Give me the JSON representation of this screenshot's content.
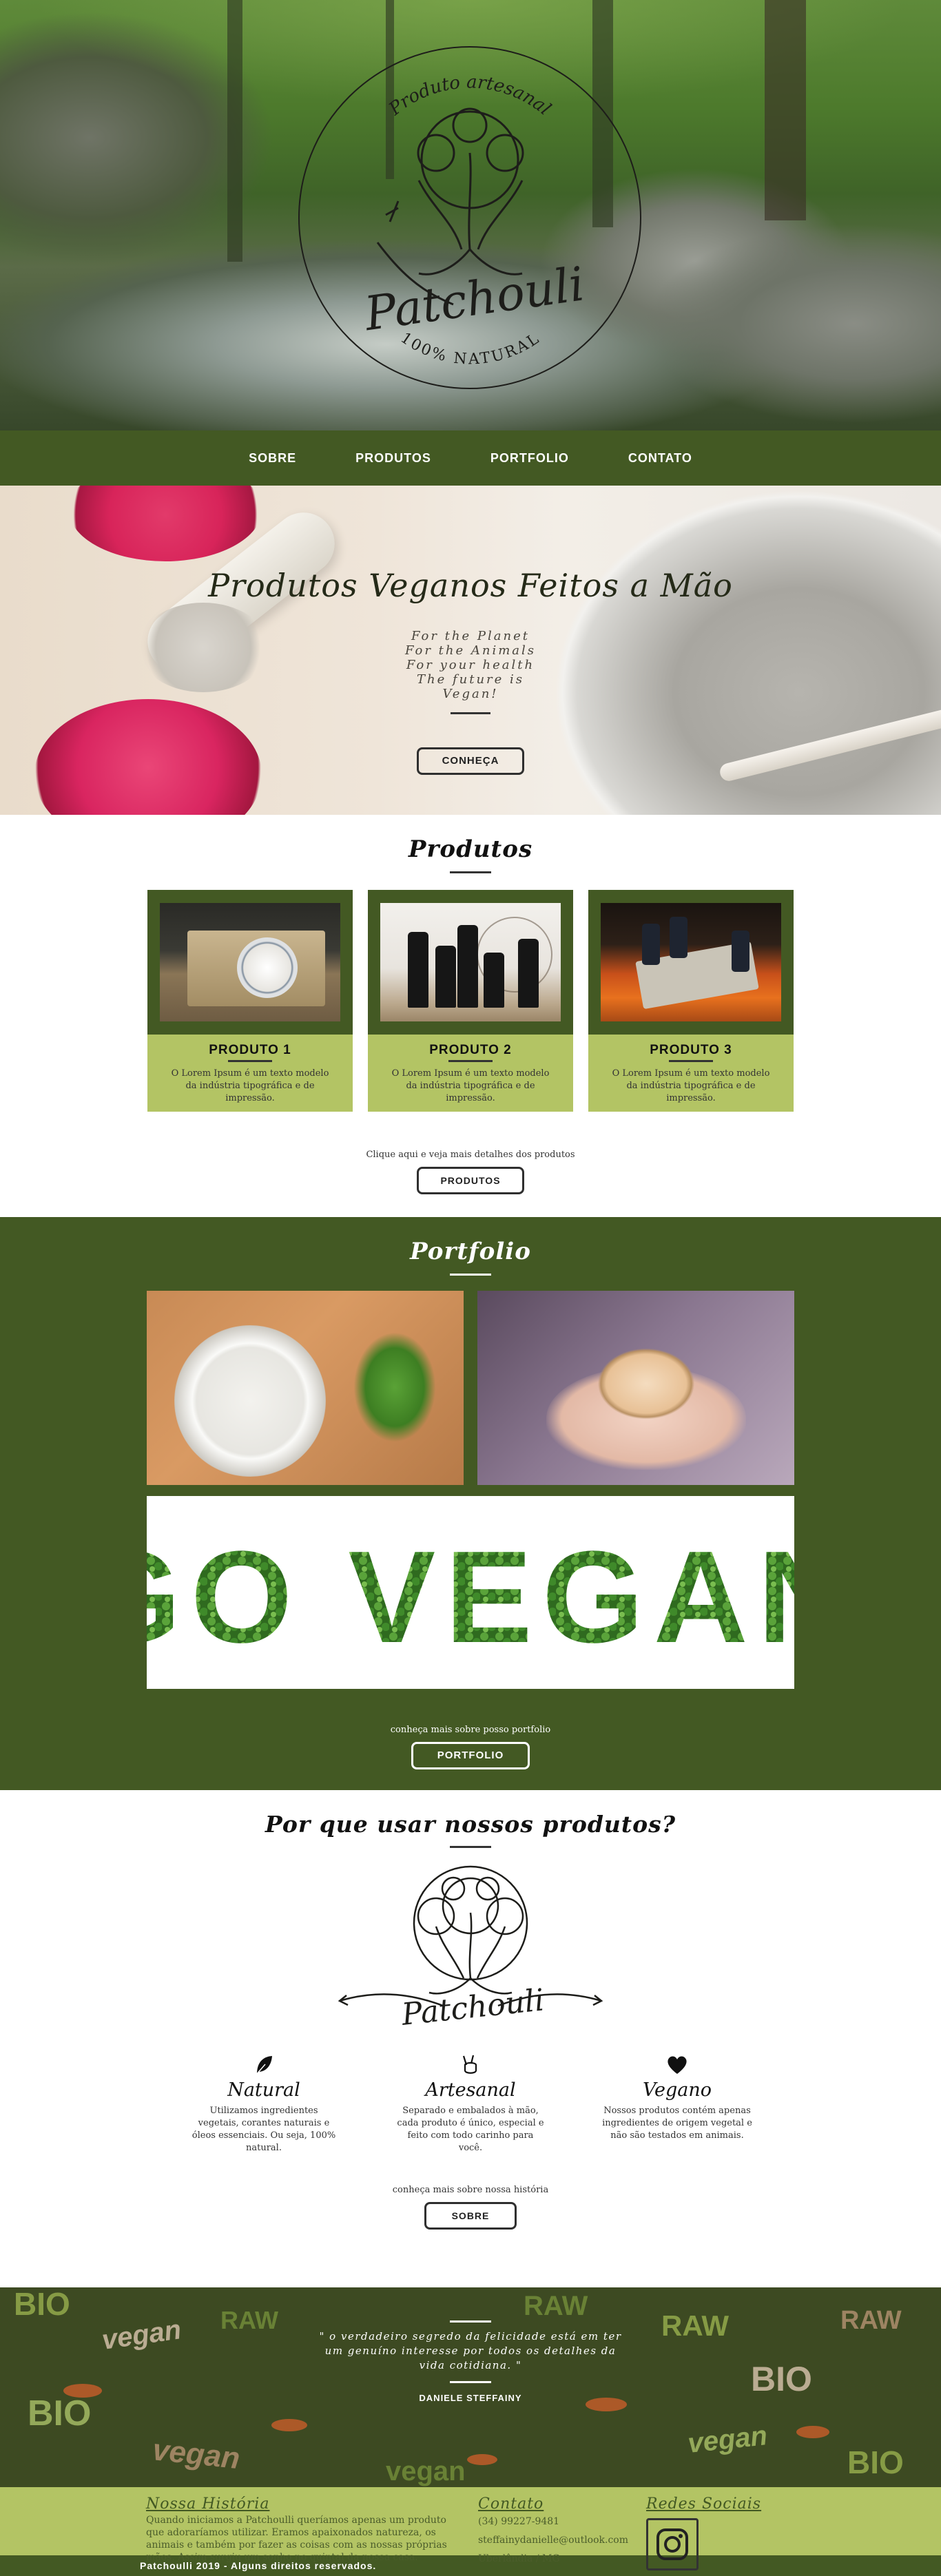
{
  "hero": {
    "logo_top_text": "Produto artesanal",
    "logo_name": "Patchouli",
    "logo_bottom_text": "100% NATURAL"
  },
  "nav": {
    "items": [
      "SOBRE",
      "PRODUTOS",
      "PORTFOLIO",
      "CONTATO"
    ]
  },
  "banner": {
    "title": "Produtos Veganos Feitos a Mão",
    "tagline": [
      "For the Planet",
      "For the Animals",
      "For your health",
      "The future is",
      "Vegan!"
    ],
    "button": "CONHEÇA"
  },
  "produtos": {
    "title": "Produtos",
    "cards": [
      {
        "name": "PRODUTO 1",
        "text": "O Lorem Ipsum é um texto modelo da indústria tipográfica e de impressão."
      },
      {
        "name": "PRODUTO 2",
        "text": "O Lorem Ipsum é um texto modelo da indústria tipográfica e de impressão."
      },
      {
        "name": "PRODUTO 3",
        "text": "O Lorem Ipsum é um texto modelo da indústria tipográfica e de impressão."
      }
    ],
    "hint": "Clique aqui e veja mais detalhes dos produtos",
    "button": "PRODUTOS"
  },
  "portfolio": {
    "title": "Portfolio",
    "banner_text": "GO VEGAN",
    "hint": "conheça mais sobre posso portfolio",
    "button": "PORTFOLIO"
  },
  "why": {
    "title": "Por que usar nossos produtos?",
    "logo_name": "Patchouli",
    "features": [
      {
        "icon": "leaf-icon",
        "title": "Natural",
        "text": "Utilizamos ingredientes vegetais, corantes naturais e óleos essenciais. Ou seja, 100% natural."
      },
      {
        "icon": "peace-hand-icon",
        "title": "Artesanal",
        "text": "Separado e embalados à mão, cada produto é único, especial e feito com todo carinho para você."
      },
      {
        "icon": "heart-icon",
        "title": "Vegano",
        "text": "Nossos produtos contém apenas ingredientes de origem vegetal e não são testados em animais."
      }
    ],
    "hint": "conheça mais sobre nossa história",
    "button": "SOBRE"
  },
  "quote": {
    "lines": [
      "\" o verdadeiro segredo da felicidade está em ter",
      "um genuíno interesse por todos os detalhes da",
      "vida cotidiana. \""
    ],
    "author": "DANIELE STEFFAINY",
    "pattern_words": [
      "BIO",
      "vegan",
      "RAW",
      "BIO",
      "vegan",
      "RAW"
    ]
  },
  "footer": {
    "history_title": "Nossa História",
    "history_text": "Quando iniciamos a Patchoulli queríamos apenas um produto que adoraríamos utilizar. Eramos apaixonados natureza, os animais e também por fazer as coisas com as nossas próprias mãos. Assim surgiu um sonho no quintal da nossa casa.",
    "contact_title": "Contato",
    "phone": "(34) 99227-9481",
    "email": "steffainydanielle@outlook.com",
    "city": "Uberlândia / MG",
    "social_title": "Redes Sociais",
    "social_icon": "instagram-icon"
  },
  "copyright": "Patchoulli 2019 - Alguns direitos reservados.",
  "colors": {
    "dark_green": "#435923",
    "light_green": "#b3c464"
  }
}
